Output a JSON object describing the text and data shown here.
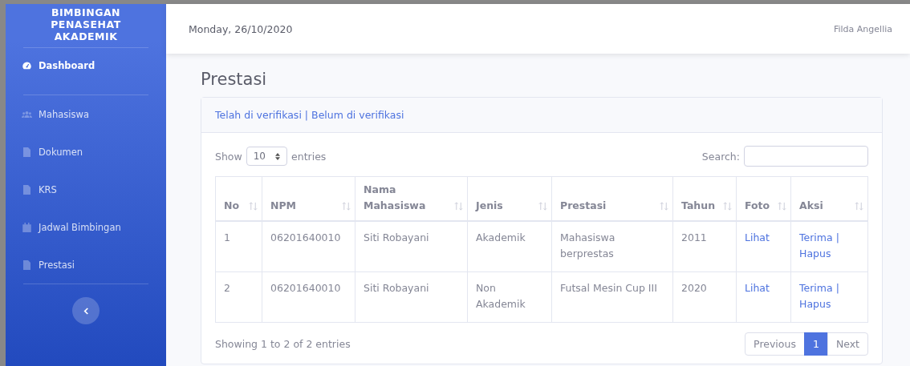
{
  "sidebar": {
    "brand": "BIMBINGAN PENASEHAT AKADEMIK",
    "items": [
      {
        "label": "Dashboard",
        "kind": "dashboard",
        "selected": true
      },
      {
        "label": "Mahasiswa",
        "kind": "people",
        "selected": false
      },
      {
        "label": "Dokumen",
        "kind": "document",
        "selected": false
      },
      {
        "label": "KRS",
        "kind": "document",
        "selected": false
      },
      {
        "label": "Jadwal Bimbingan",
        "kind": "schedule",
        "selected": false
      },
      {
        "label": "Prestasi",
        "kind": "document",
        "selected": false
      }
    ]
  },
  "topbar": {
    "date": "Monday, 26/10/2020",
    "user": "Filda Angellia"
  },
  "page_title": "Prestasi",
  "card": {
    "filters": [
      "Telah di verifikasi",
      "Belum di verifikasi"
    ],
    "filter_separator": "|",
    "length": {
      "show": "Show",
      "value": "10",
      "entries": "entries"
    },
    "search_label": "Search:",
    "table": {
      "columns": [
        "No",
        "NPM",
        "Nama Mahasiswa",
        "Jenis",
        "Prestasi",
        "Tahun",
        "Foto",
        "Aksi"
      ],
      "rows": [
        {
          "no": "1",
          "npm": "06201640010",
          "nama": "Siti Robayani",
          "jenis": "Akademik",
          "prestasi": "Mahasiswa berprestas",
          "tahun": "2011",
          "foto": "Lihat",
          "accept": "Terima",
          "delete": "Hapus"
        },
        {
          "no": "2",
          "npm": "06201640010",
          "nama": "Siti Robayani",
          "jenis": "Non Akademik",
          "prestasi": "Futsal Mesin Cup III",
          "tahun": "2020",
          "foto": "Lihat",
          "accept": "Terima",
          "delete": "Hapus"
        }
      ]
    },
    "info": "Showing 1 to 2 of 2 entries",
    "pagination": [
      {
        "label": "Previous",
        "selected": false
      },
      {
        "label": "1",
        "selected": true
      },
      {
        "label": "Next",
        "selected": false
      }
    ]
  }
}
